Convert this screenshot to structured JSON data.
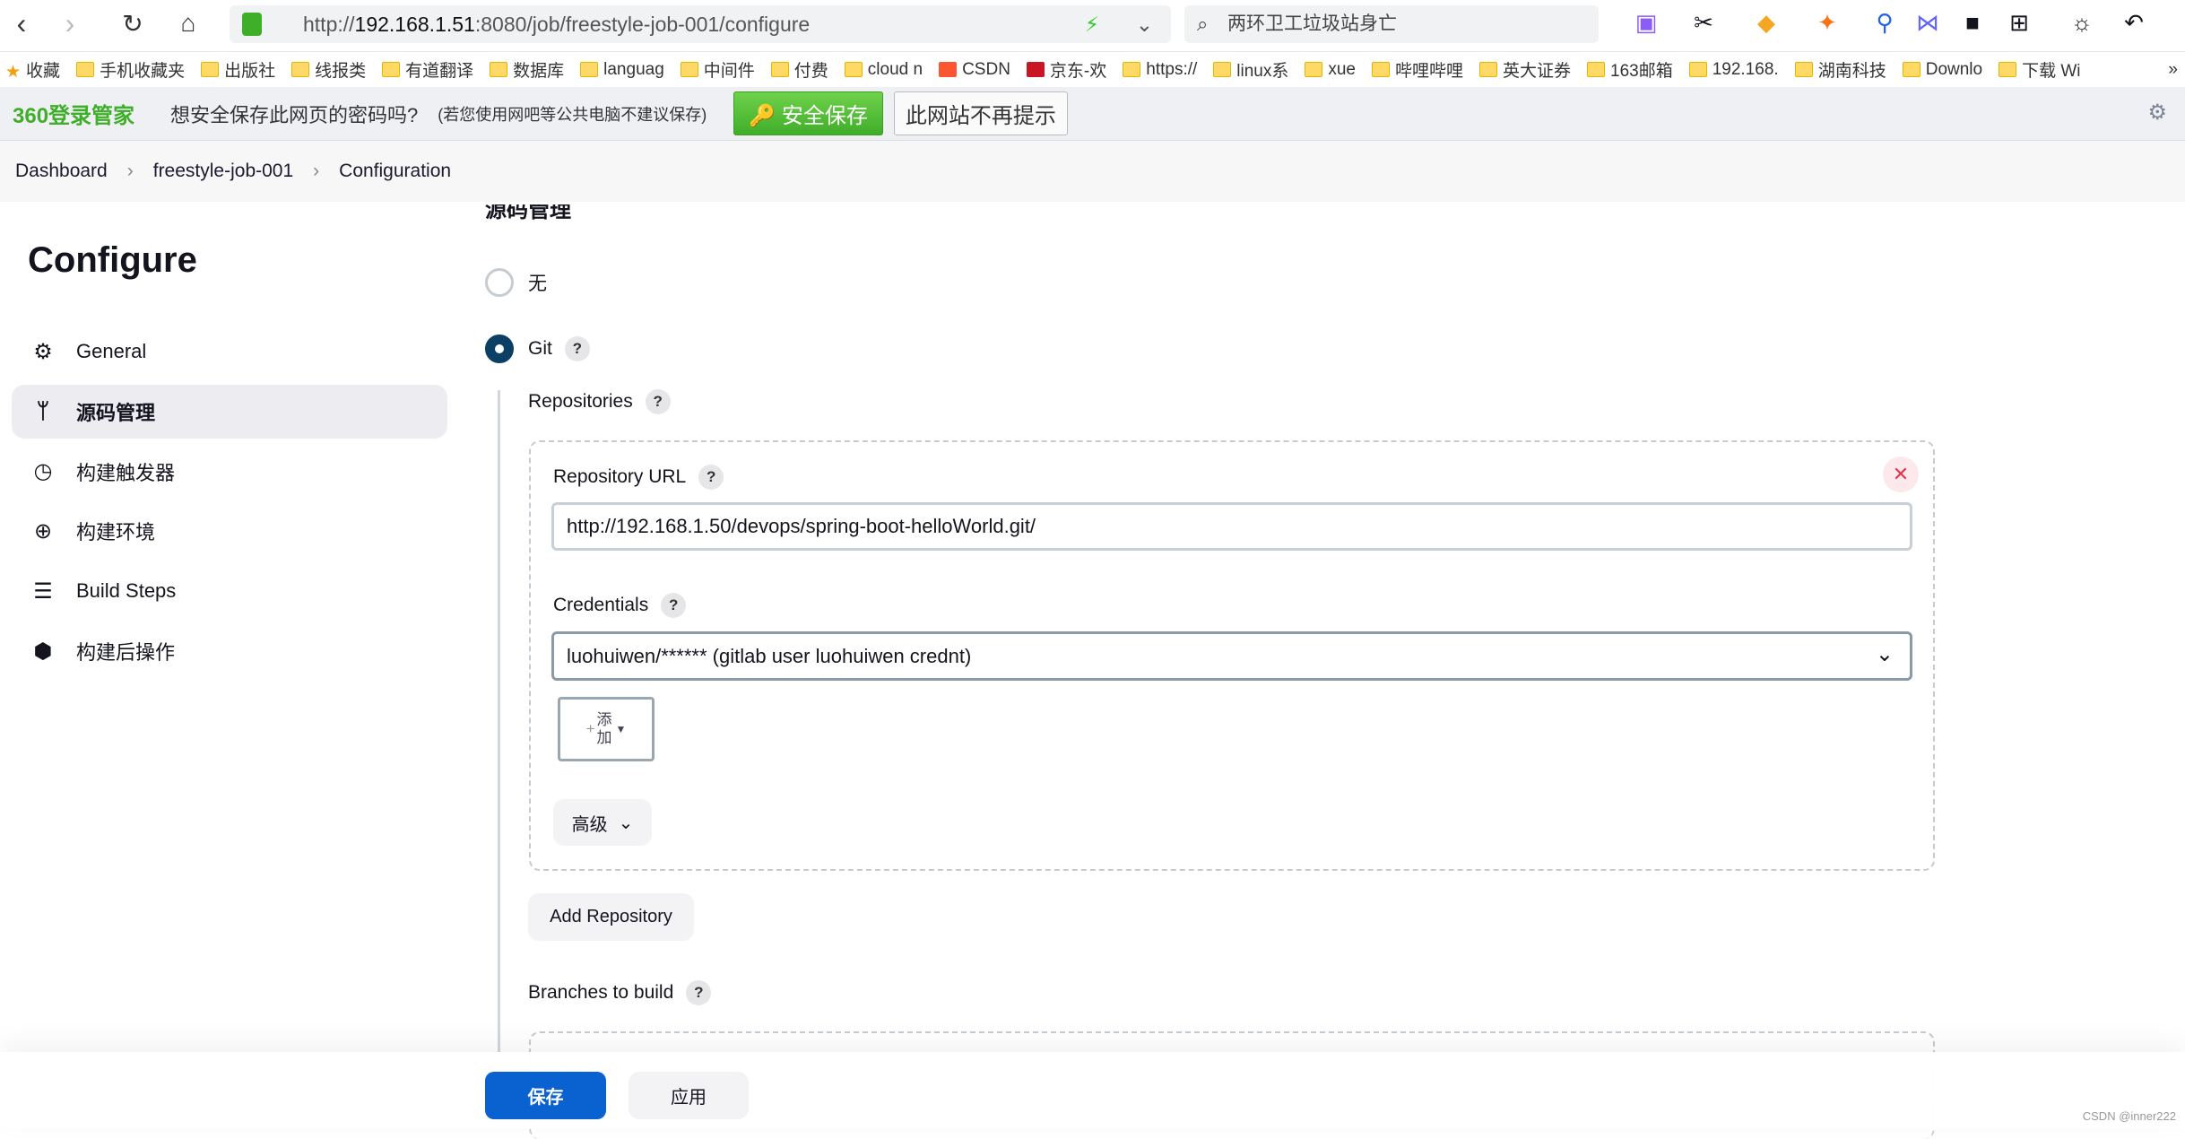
{
  "browser": {
    "url_prefix": "http://",
    "url_host": "192.168.1.51",
    "url_rest": ":8080/job/freestyle-job-001/configure",
    "search_text": "两环卫工垃圾站身亡",
    "bookmarks": [
      "收藏",
      "手机收藏夹",
      "出版社",
      "线报类",
      "有道翻译",
      "数据库",
      "languag",
      "中间件",
      "付费",
      "cloud n",
      "CSDN",
      "京东-欢",
      "https://",
      "linux系",
      "xue",
      "哔哩哔哩",
      "英大证券",
      "163邮箱",
      "192.168.",
      "湖南科技",
      "Downlo",
      "下载 Wi"
    ],
    "more": "»"
  },
  "pwbar": {
    "logo": "360登录管家",
    "question": "想安全保存此网页的密码吗?",
    "hint": "(若您使用网吧等公共电脑不建议保存)",
    "save": "安全保存",
    "never": "此网站不再提示"
  },
  "breadcrumb": [
    "Dashboard",
    "freestyle-job-001",
    "Configuration"
  ],
  "sidebar": {
    "title": "Configure",
    "items": [
      {
        "label": "General",
        "icon": "gear-icon"
      },
      {
        "label": "源码管理",
        "icon": "branch-icon",
        "active": true
      },
      {
        "label": "构建触发器",
        "icon": "timer-icon"
      },
      {
        "label": "构建环境",
        "icon": "globe-icon"
      },
      {
        "label": "Build Steps",
        "icon": "list-icon"
      },
      {
        "label": "构建后操作",
        "icon": "package-icon"
      }
    ]
  },
  "main": {
    "section": "源码管理",
    "scm_none": "无",
    "scm_git": "Git",
    "help": "?",
    "repositories": "Repositories",
    "repo_url_label": "Repository URL",
    "repo_url": "http://192.168.1.50/devops/spring-boot-helloWorld.git/",
    "credentials_label": "Credentials",
    "credentials": "luohuiwen/****** (gitlab user luohuiwen crednt)",
    "add_top": "添",
    "add_bottom": "加",
    "advanced": "高级",
    "add_repository": "Add Repository",
    "branches": "Branches to build"
  },
  "footer": {
    "save": "保存",
    "apply": "应用"
  },
  "watermark": "CSDN @inner222",
  "colors": {
    "primary": "#0a62d0",
    "radio": "#0b3f63",
    "green": "#3fae29"
  }
}
